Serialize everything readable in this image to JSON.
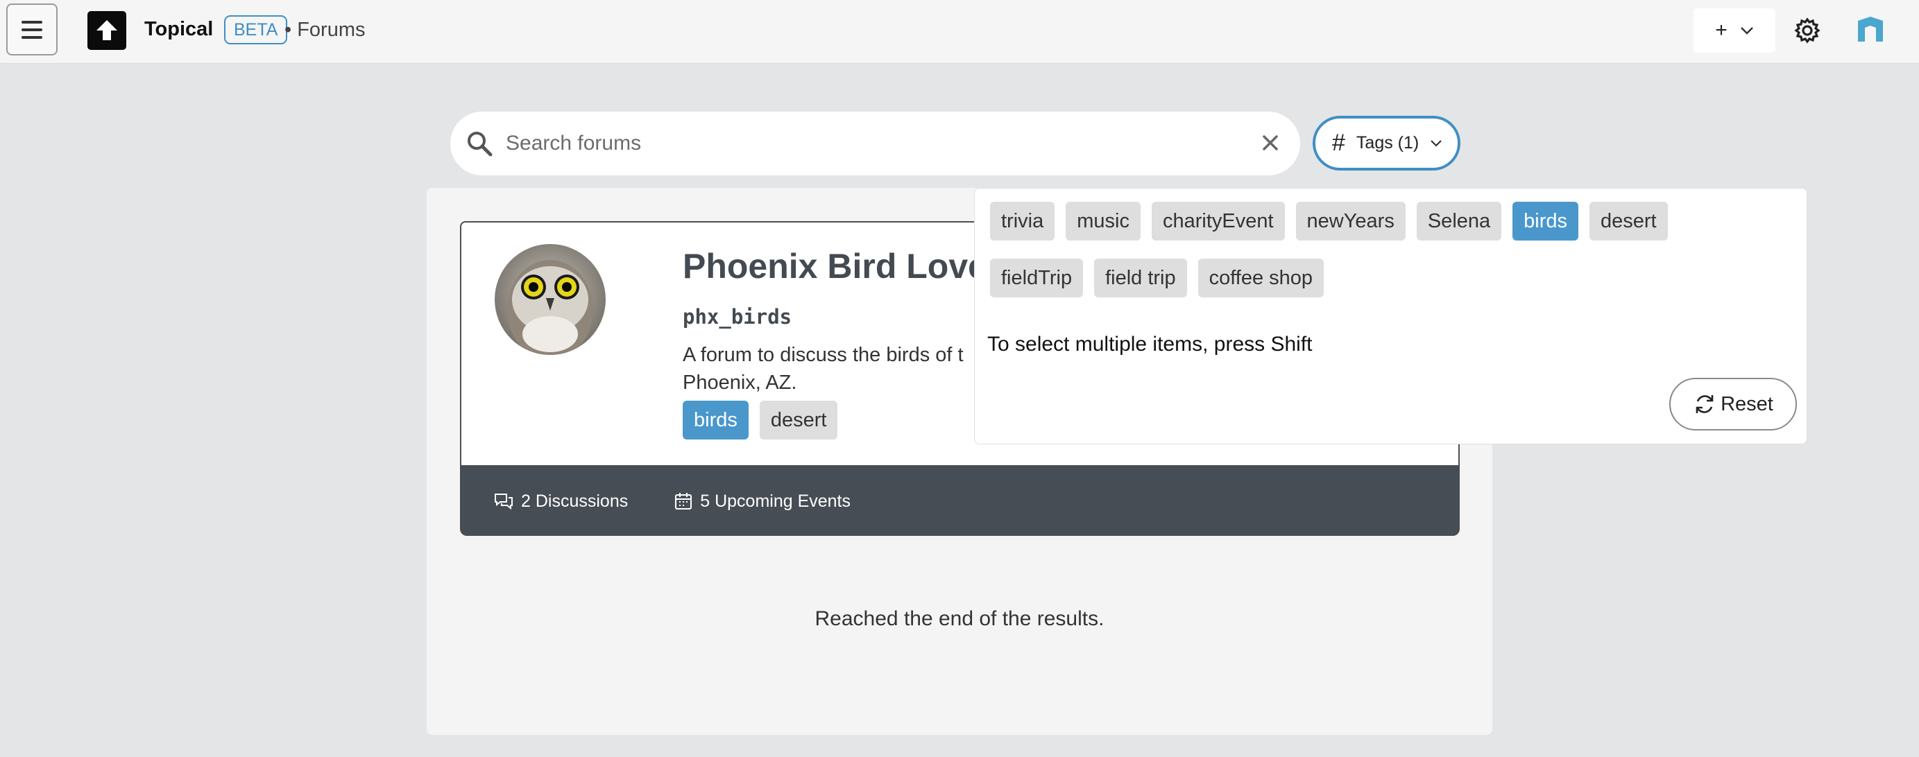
{
  "header": {
    "brand": "Topical",
    "beta": "BETA",
    "breadcrumb": "• Forums",
    "add_label": "+"
  },
  "search": {
    "placeholder": "Search forums",
    "value": ""
  },
  "tags_button": {
    "label": "Tags (1)"
  },
  "forum_card": {
    "title": "Phoenix Bird Love",
    "handle": "phx_birds",
    "description": "A forum to discuss the birds of t Phoenix, AZ.",
    "description_line1": "A forum to discuss the birds of t",
    "description_line2": "Phoenix, AZ.",
    "tags": [
      {
        "label": "birds",
        "selected": true
      },
      {
        "label": "desert",
        "selected": false
      }
    ],
    "discussions": "2 Discussions",
    "events": "5 Upcoming Events"
  },
  "results_end": "Reached the end of the results.",
  "tags_dropdown": {
    "row1": [
      {
        "label": "trivia",
        "selected": false
      },
      {
        "label": "music",
        "selected": false
      },
      {
        "label": "charityEvent",
        "selected": false
      },
      {
        "label": "newYears",
        "selected": false
      },
      {
        "label": "Selena",
        "selected": false
      },
      {
        "label": "birds",
        "selected": true
      },
      {
        "label": "desert",
        "selected": false
      }
    ],
    "row2": [
      {
        "label": "fieldTrip",
        "selected": false
      },
      {
        "label": "field trip",
        "selected": false
      },
      {
        "label": "coffee shop",
        "selected": false
      }
    ],
    "hint": "To select multiple items, press Shift",
    "reset_label": "Reset"
  },
  "colors": {
    "accent": "#4a97cc",
    "footer": "#474d54",
    "background": "#e4e5e7"
  }
}
